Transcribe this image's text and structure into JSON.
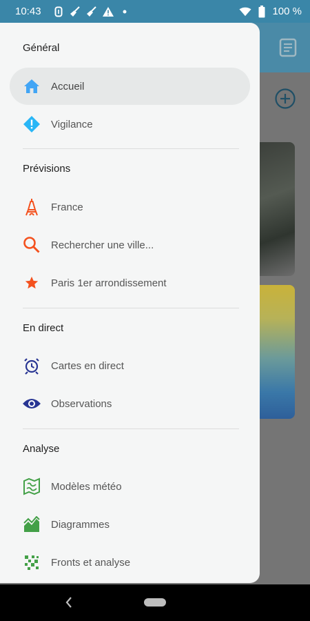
{
  "status_bar": {
    "time": "10:43",
    "battery": "100 %"
  },
  "drawer": {
    "sections": {
      "general": "Général",
      "previsions": "Prévisions",
      "en_direct": "En direct",
      "analyse": "Analyse"
    },
    "items": {
      "accueil": "Accueil",
      "vigilance": "Vigilance",
      "france": "France",
      "rechercher": "Rechercher une ville...",
      "paris": "Paris 1er arrondissement",
      "cartes": "Cartes en direct",
      "observations": "Observations",
      "modeles": "Modèles météo",
      "diagrammes": "Diagrammes",
      "fronts": "Fronts et analyse"
    },
    "active_item": "Accueil"
  },
  "colors": {
    "status_bar": "#3a86a8",
    "drawer_bg": "#f5f6f6",
    "accueil_icon": "#42a5f5",
    "vigilance_icon": "#29b6f6",
    "previsions_icons": "#f4511e",
    "paris_star": "#f4511e",
    "direct_icons": "#283593",
    "analyse_icons": "#43a047"
  },
  "icons": [
    "home-icon",
    "vigilance-diamond-icon",
    "eiffel-tower-icon",
    "search-icon",
    "star-icon",
    "clock-refresh-icon",
    "eye-icon",
    "map-icon",
    "area-chart-icon",
    "dots-grid-icon",
    "document-icon",
    "add-circle-icon",
    "back-icon"
  ]
}
